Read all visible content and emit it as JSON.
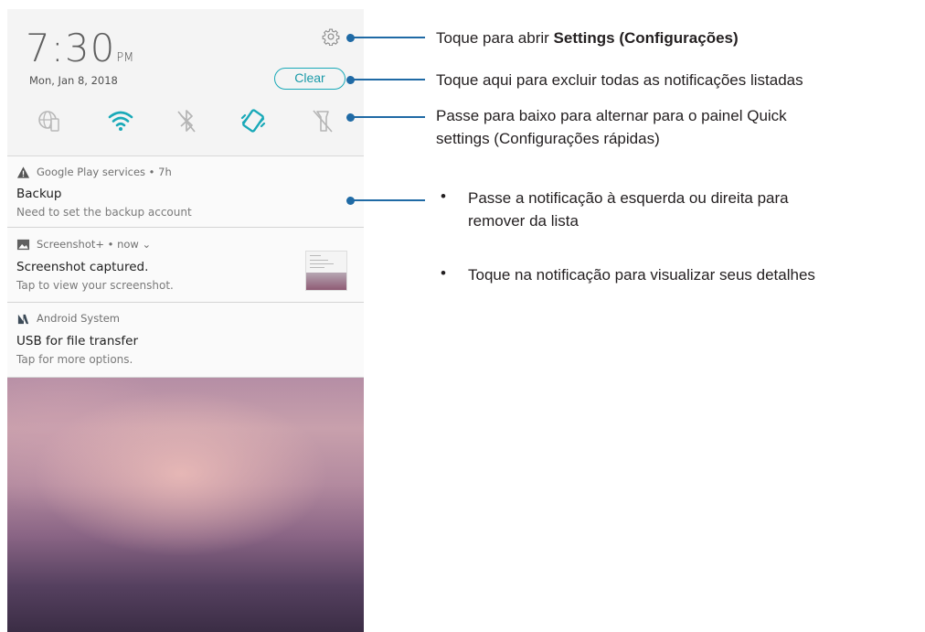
{
  "status": {
    "time": "7:30",
    "ampm": "PM",
    "date": "Mon, Jan 8, 2018",
    "clear_label": "Clear"
  },
  "quick_settings": [
    "globe-phone-icon",
    "wifi-icon",
    "bluetooth-off-icon",
    "vibrate-icon",
    "flashlight-off-icon"
  ],
  "notifications": [
    {
      "app": "Google Play services • 7h",
      "icon": "warning-icon",
      "title": "Backup",
      "body": "Need to set the backup account"
    },
    {
      "app": "Screenshot+ • now ⌄",
      "icon": "image-icon",
      "title": "Screenshot captured.",
      "body": "Tap to view your screenshot."
    },
    {
      "app": "Android System",
      "icon": "android-system-icon",
      "title": "USB for file transfer",
      "body": "Tap for more options."
    }
  ],
  "callouts": {
    "settings_prefix": "Toque para abrir ",
    "settings_bold": "Settings (Configurações)",
    "clear": "Toque aqui para excluir todas as notificações listadas",
    "quick_line1": "Passe para baixo para alternar para o painel Quick",
    "quick_line2": "settings (Configurações rápidas)",
    "swipe_line1": "Passe a notificação à esquerda ou direita para",
    "swipe_line2": "remover da lista",
    "tap": "Toque na notificação para visualizar seus detalhes",
    "bullet": "•"
  },
  "colors": {
    "accent": "#19a9b8",
    "callout": "#1f6aa5"
  }
}
